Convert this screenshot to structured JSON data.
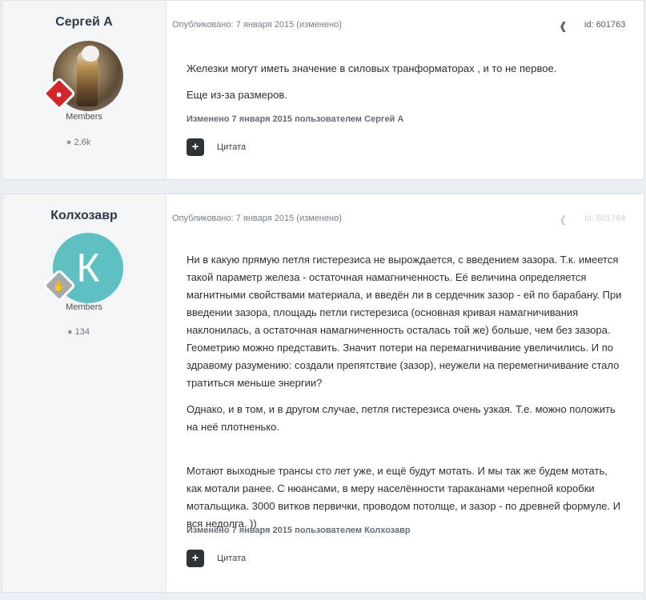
{
  "posts": [
    {
      "author": "Сергей А",
      "role": "Members",
      "post_count": "2,6k",
      "meta": "Опубликовано: 7 января 2015 (изменено)",
      "id_label": "id: 601763",
      "paragraphs": [
        "Железки могут иметь значение в силовых транформаторах , и то не первое.",
        "Еще из-за размеров."
      ],
      "edited": "Изменено 7 января 2015 пользователем Сергей А",
      "quote_label": "Цитата"
    },
    {
      "author": "Колхозавр",
      "avatar_letter": "К",
      "role": "Members",
      "post_count": "134",
      "meta": "Опубликовано: 7 января 2015 (изменено)",
      "id_label": "id: 601764",
      "paragraphs": [
        "Ни в какую прямую петля гистерезиса не вырождается, с введением зазора. Т.к. имеется такой параметр железа - остаточная намагниченность. Её величина определяется магнитными свойствами материала, и введён ли в сердечник зазор - ей по барабану. При введении зазора, площадь петли гистерезиса (основная кривая намагничивания наклонилась, а остаточная намагниченность осталась той же) больше, чем без зазора. Геометрию можно представить. Значит потери на перемагничивание увеличились. И по здравому разумению: создали препятствие (зазор), неужели на перемегничивание стало тратиться меньше энергии?",
        "Однако, и в том, и в другом случае, петля гистерезиса очень узкая. Т.е. можно положить на неё плотненько.",
        "Мотают выходные трансы сто лет уже, и ещё будут мотать. И мы так же будем мотать, как мотали ранее. С нюансами, в меру населённости тараканами черепной коробки мотальщика. 3000 витков первички, проводом потолще, и зазор - по древней формуле. И вся недолга. ))"
      ],
      "edited": "Изменено 7 января 2015 пользователем Колхозавр",
      "quote_label": "Цитата"
    }
  ],
  "icons": {
    "share": "share-icon",
    "comment": "comment-icon",
    "plus": "plus-icon",
    "badge_red": "lightbulb-badge-icon",
    "badge_grey": "hand-badge-icon"
  },
  "colors": {
    "badge_red": "#d3272c",
    "avatar_teal": "#5ec0c1",
    "badge_grey": "#a7a9ac"
  }
}
